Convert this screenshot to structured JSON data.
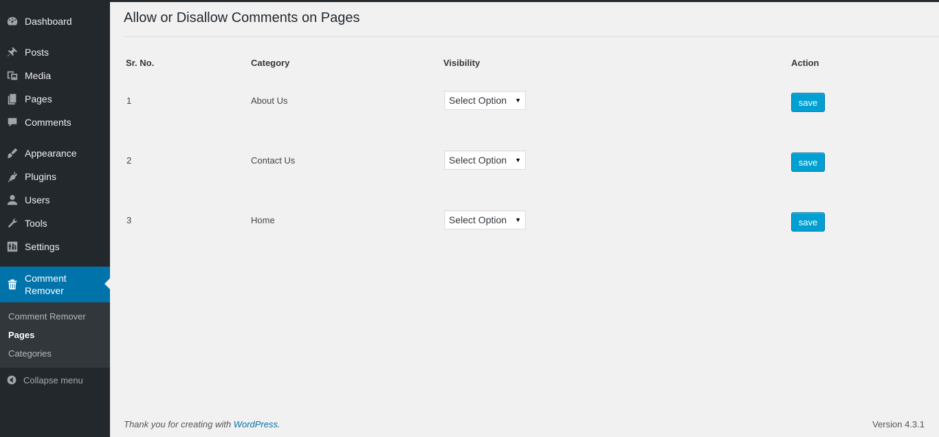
{
  "sidebar": {
    "items": [
      {
        "label": "Dashboard",
        "icon": "dashboard-icon"
      },
      {
        "label": "Posts",
        "icon": "pin-icon"
      },
      {
        "label": "Media",
        "icon": "media-icon"
      },
      {
        "label": "Pages",
        "icon": "pages-icon"
      },
      {
        "label": "Comments",
        "icon": "comment-icon"
      },
      {
        "label": "Appearance",
        "icon": "brush-icon"
      },
      {
        "label": "Plugins",
        "icon": "plugin-icon"
      },
      {
        "label": "Users",
        "icon": "user-icon"
      },
      {
        "label": "Tools",
        "icon": "wrench-icon"
      },
      {
        "label": "Settings",
        "icon": "settings-icon"
      }
    ],
    "active": {
      "label": "Comment Remover",
      "icon": "trash-icon"
    },
    "submenu": [
      {
        "label": "Comment Remover"
      },
      {
        "label": "Pages"
      },
      {
        "label": "Categories"
      }
    ],
    "collapse_label": "Collapse menu"
  },
  "main": {
    "title": "Allow or Disallow Comments on Pages",
    "table": {
      "headers": [
        "Sr. No.",
        "Category",
        "Visibility",
        "Action"
      ],
      "rows": [
        {
          "sr": "1",
          "category": "About Us",
          "visibility": "Select Option",
          "action": "save"
        },
        {
          "sr": "2",
          "category": "Contact Us",
          "visibility": "Select Option",
          "action": "save"
        },
        {
          "sr": "3",
          "category": "Home",
          "visibility": "Select Option",
          "action": "save"
        }
      ]
    }
  },
  "footer": {
    "thanks_prefix": "Thank you for creating with ",
    "thanks_link": "WordPress",
    "thanks_suffix": ".",
    "version": "Version 4.3.1"
  },
  "colors": {
    "sidebar_bg": "#23282d",
    "active_bg": "#0073aa",
    "submenu_bg": "#32373c",
    "button_bg": "#00a0d2",
    "page_bg": "#f1f1f1"
  }
}
